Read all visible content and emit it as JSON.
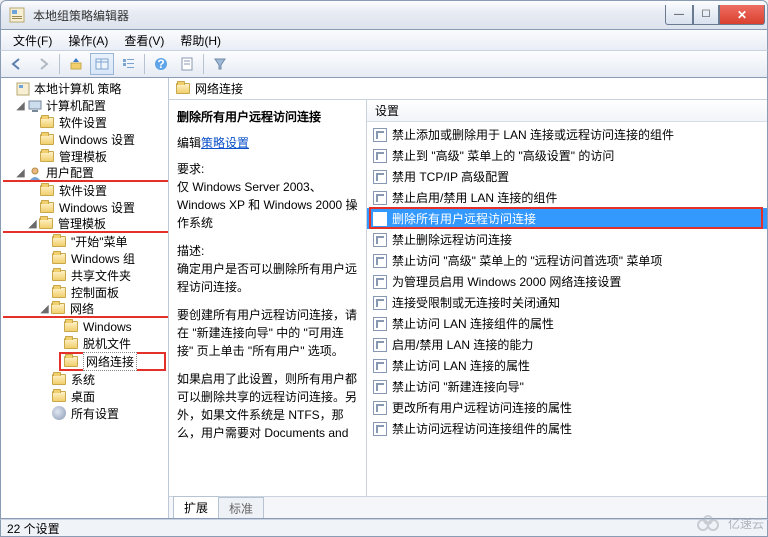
{
  "window": {
    "title": "本地组策略编辑器",
    "min": "—",
    "max": "☐",
    "close": "✕"
  },
  "menu": {
    "file": "文件(F)",
    "action": "操作(A)",
    "view": "查看(V)",
    "help": "帮助(H)"
  },
  "tree": {
    "root": "本地计算机 策略",
    "computer": "计算机配置",
    "c_soft": "软件设置",
    "c_win": "Windows 设置",
    "c_admin": "管理模板",
    "user": "用户配置",
    "u_soft": "软件设置",
    "u_win": "Windows 设置",
    "u_admin": "管理模板",
    "start": "\"开始\"菜单",
    "wincomp": "Windows 组",
    "share": "共享文件夹",
    "ctrl": "控制面板",
    "net": "网络",
    "net_win": "Windows",
    "net_off": "脱机文件",
    "net_conn": "网络连接",
    "sys": "系统",
    "desk": "桌面",
    "all": "所有设置"
  },
  "crumb": {
    "label": "网络连接"
  },
  "desc": {
    "title": "删除所有用户远程访问连接",
    "edit_prefix": "编辑",
    "edit_link": "策略设置",
    "req_h": "要求:",
    "req_body": "仅 Windows Server 2003、Windows XP 和 Windows 2000 操作系统",
    "desc_h": "描述:",
    "desc_body": "确定用户是否可以删除所有用户远程访问连接。",
    "p2": "要创建所有用户远程访问连接，请在 \"新建连接向导\" 中的 \"可用连接\" 页上单击 \"所有用户\" 选项。",
    "p3": "如果启用了此设置，则所有用户都可以删除共享的远程访问连接。另外，如果文件系统是 NTFS，那么，用户需要对 Documents and"
  },
  "listhdr": "设置",
  "list": [
    "禁止添加或删除用于 LAN 连接或远程访问连接的组件",
    "禁止到 \"高级\" 菜单上的 \"高级设置\" 的访问",
    "禁用 TCP/IP 高级配置",
    "禁止启用/禁用 LAN 连接的组件",
    "删除所有用户远程访问连接",
    "禁止删除远程访问连接",
    "禁止访问 \"高级\" 菜单上的 \"远程访问首选项\" 菜单项",
    "为管理员启用 Windows 2000 网络连接设置",
    "连接受限制或无连接时关闭通知",
    "禁止访问 LAN 连接组件的属性",
    "启用/禁用 LAN 连接的能力",
    "禁止访问 LAN 连接的属性",
    "禁止访问 \"新建连接向导\"",
    "更改所有用户远程访问连接的属性",
    "禁止访问远程访问连接组件的属性"
  ],
  "selected_index": 4,
  "tabs": {
    "ext": "扩展",
    "std": "标准"
  },
  "status": "22 个设置",
  "watermark": "亿速云"
}
